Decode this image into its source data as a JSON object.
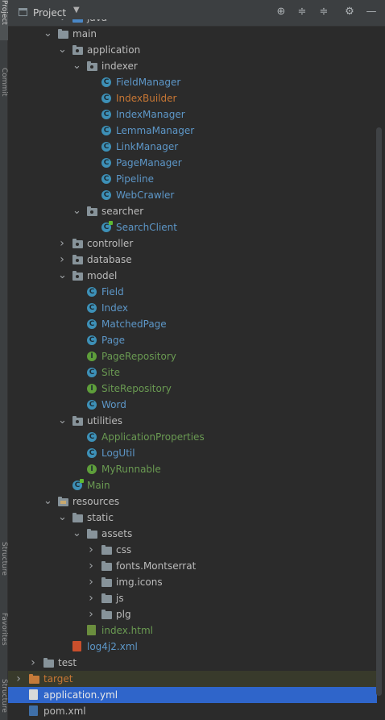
{
  "side_tabs": {
    "project": "Project",
    "commit": "Commit",
    "structure": "Structure",
    "favorites": "Favorites",
    "structure2": "Structure"
  },
  "header": {
    "title": "Project",
    "dropdown_icon": "chevron-down-icon",
    "buttons": [
      "locate-icon",
      "expand-all-icon",
      "collapse-all-icon",
      "gear-icon",
      "minimize-icon"
    ]
  },
  "tree": [
    {
      "label": "java",
      "type": "folder-src",
      "indent": 4,
      "expanded": true
    },
    {
      "label": "main",
      "type": "folder",
      "indent": 3,
      "expanded": true
    },
    {
      "label": "application",
      "type": "package",
      "indent": 4,
      "expanded": true
    },
    {
      "label": "indexer",
      "type": "package",
      "indent": 5,
      "expanded": true
    },
    {
      "label": "FieldManager",
      "type": "class",
      "indent": 6
    },
    {
      "label": "IndexBuilder",
      "type": "class",
      "indent": 6,
      "color": "orange"
    },
    {
      "label": "IndexManager",
      "type": "class",
      "indent": 6
    },
    {
      "label": "LemmaManager",
      "type": "class",
      "indent": 6
    },
    {
      "label": "LinkManager",
      "type": "class",
      "indent": 6
    },
    {
      "label": "PageManager",
      "type": "class",
      "indent": 6
    },
    {
      "label": "Pipeline",
      "type": "class",
      "indent": 6
    },
    {
      "label": "WebCrawler",
      "type": "class",
      "indent": 6
    },
    {
      "label": "searcher",
      "type": "package",
      "indent": 5,
      "expanded": true
    },
    {
      "label": "SearchClient",
      "type": "class-run",
      "indent": 6
    },
    {
      "label": "controller",
      "type": "package",
      "indent": 4,
      "expanded": false
    },
    {
      "label": "database",
      "type": "package",
      "indent": 4,
      "expanded": false
    },
    {
      "label": "model",
      "type": "package",
      "indent": 4,
      "expanded": true
    },
    {
      "label": "Field",
      "type": "class",
      "indent": 5
    },
    {
      "label": "Index",
      "type": "class",
      "indent": 5
    },
    {
      "label": "MatchedPage",
      "type": "class",
      "indent": 5
    },
    {
      "label": "Page",
      "type": "class",
      "indent": 5
    },
    {
      "label": "PageRepository",
      "type": "interface",
      "indent": 5
    },
    {
      "label": "Site",
      "type": "class",
      "indent": 5,
      "color": "green"
    },
    {
      "label": "SiteRepository",
      "type": "interface",
      "indent": 5
    },
    {
      "label": "Word",
      "type": "class",
      "indent": 5
    },
    {
      "label": "utilities",
      "type": "package",
      "indent": 4,
      "expanded": true
    },
    {
      "label": "ApplicationProperties",
      "type": "class",
      "indent": 5,
      "color": "green"
    },
    {
      "label": "LogUtil",
      "type": "class",
      "indent": 5
    },
    {
      "label": "MyRunnable",
      "type": "interface",
      "indent": 5
    },
    {
      "label": "Main",
      "type": "class-run",
      "indent": 4,
      "color": "green"
    },
    {
      "label": "resources",
      "type": "folder-res",
      "indent": 3,
      "expanded": true
    },
    {
      "label": "static",
      "type": "folder",
      "indent": 4,
      "expanded": true
    },
    {
      "label": "assets",
      "type": "folder",
      "indent": 5,
      "expanded": true
    },
    {
      "label": "css",
      "type": "folder",
      "indent": 6,
      "expanded": false
    },
    {
      "label": "fonts.Montserrat",
      "type": "folder",
      "indent": 6,
      "expanded": false
    },
    {
      "label": "img.icons",
      "type": "folder",
      "indent": 6,
      "expanded": false
    },
    {
      "label": "js",
      "type": "folder",
      "indent": 6,
      "expanded": false
    },
    {
      "label": "plg",
      "type": "folder",
      "indent": 6,
      "expanded": false
    },
    {
      "label": "index.html",
      "type": "file-html",
      "indent": 5,
      "color": "green"
    },
    {
      "label": "log4j2.xml",
      "type": "file-xml",
      "indent": 4,
      "color": "blue"
    },
    {
      "label": "test",
      "type": "folder",
      "indent": 2,
      "expanded": false
    },
    {
      "label": "target",
      "type": "folder-orange",
      "indent": 1,
      "expanded": false,
      "color": "orange",
      "highlight": "light"
    },
    {
      "label": "application.yml",
      "type": "file-yml",
      "indent": 1,
      "highlight": "selected"
    },
    {
      "label": "pom.xml",
      "type": "file-pom",
      "indent": 1
    }
  ],
  "colors": {
    "blue": "#5d97c8",
    "green": "#6a9a52",
    "orange": "#c87734",
    "selection": "#2f65ca"
  }
}
